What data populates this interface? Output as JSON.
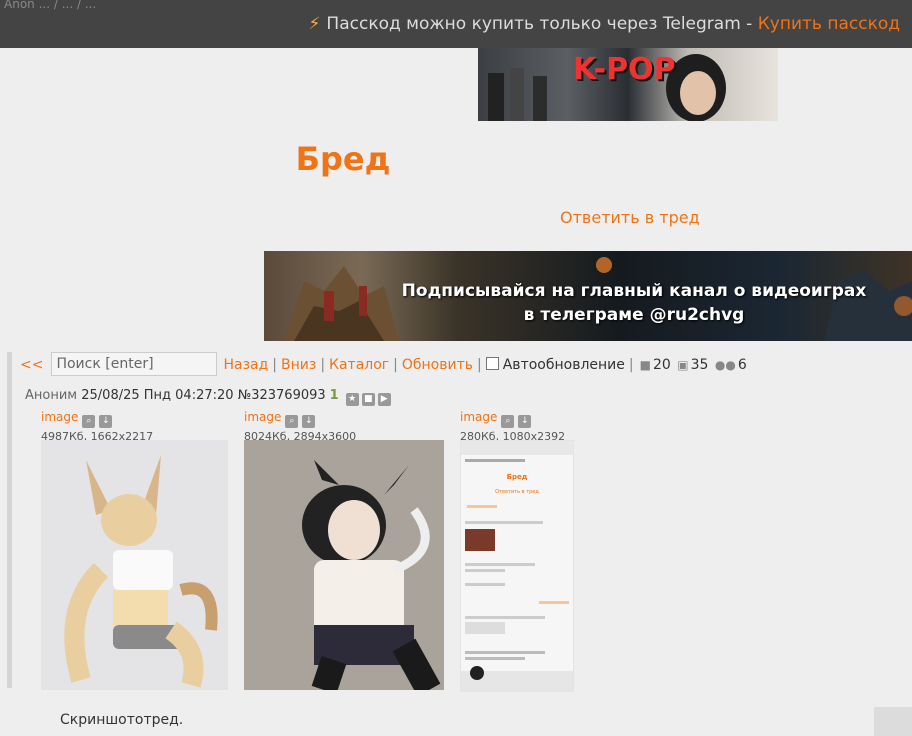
{
  "topbar": {
    "ghost_text": "Anon ... / ... / ...",
    "message": "Пасскод можно купить только через Telegram -",
    "buy_link": "Купить пасскод"
  },
  "top_banner": {
    "text": "K-POP"
  },
  "board": {
    "title": "Бред",
    "reply_link": "Ответить в тред"
  },
  "ad_banner": {
    "line1": "Подписывайся на главный канал о видеоиграх",
    "line2": "в телеграме @ru2chvg"
  },
  "toolbar": {
    "back_arrows": "<<",
    "search_placeholder": "Поиск [enter]",
    "links": [
      "Назад",
      "Вниз",
      "Каталог",
      "Обновить"
    ],
    "autoupdate_label": "Автообновление",
    "posts_count": "20",
    "images_count": "35",
    "posters_count": "6"
  },
  "post": {
    "author": "Аноним",
    "date": "25/08/25 Пнд 04:27:20",
    "number": "№323769093",
    "replies": "1",
    "text": "Скриншототред.",
    "files": [
      {
        "name": "image",
        "info": "4987Кб, 1662x2217"
      },
      {
        "name": "image",
        "info": "8024Кб, 2894x3600"
      },
      {
        "name": "image",
        "info": "280Кб, 1080x2392"
      }
    ]
  },
  "screenshot_thumb": {
    "title": "Бред",
    "reply": "Ответить в тред",
    "caption": "Скриншототред."
  },
  "colors": {
    "accent": "#f07316",
    "background": "#eeeeee",
    "topbar": "#373737"
  }
}
